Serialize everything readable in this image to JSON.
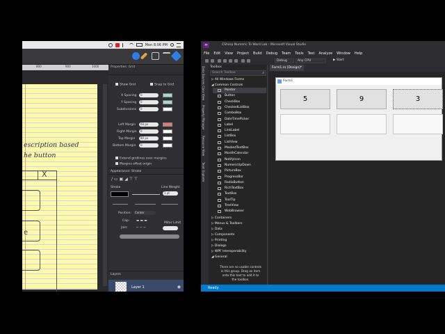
{
  "mac": {
    "menubar": {
      "clock": "Mon 8:06 PM"
    },
    "ruler": {
      "ticks": [
        "800",
        "900",
        "1000"
      ]
    },
    "pad": {
      "line1": "escription based",
      "line2": "he button",
      "x_mark": "X",
      "e_mark": "e"
    },
    "properties": {
      "title": "Properties: Grid",
      "show_grid": "Show Grid",
      "snap_to_grid": "Snap to Grid",
      "x_spacing_label": "X Spacing",
      "x_spacing_value": "0",
      "y_spacing_label": "Y Spacing",
      "y_spacing_value": "0",
      "subdivisions_label": "Subdivisions",
      "subdivisions_value": "0",
      "left_margin_label": "Left Margin",
      "left_margin_value": "60 px",
      "right_margin_label": "Right Margin",
      "right_margin_value": "0",
      "top_margin_label": "Top Margin",
      "top_margin_value": "80 px",
      "bottom_margin_label": "Bottom Margin",
      "bottom_margin_value": "0",
      "extend_gridlines": "Extend gridlines over margins",
      "margins_offset": "Margins offset origin",
      "appearance_label": "Appearance: Stroke",
      "stroke_label": "Stroke",
      "line_weight_label": "Line Weight",
      "line_weight_value": "1 pt",
      "position_label": "Position:",
      "position_value": "Center",
      "cap_label": "Cap:",
      "join_label": "Join:",
      "miter_limit_label": "Miter Limit",
      "layers_label": "Layers",
      "layer_name": "Layer 1"
    },
    "colors": {
      "swatch_teal": "#a9d8c8",
      "swatch_red": "#e27a6f",
      "pad_yellow": "#fff9a8"
    }
  },
  "vs": {
    "window_title": "CSharp Numeric To Word Lab - Microsoft Visual Studio",
    "menu": [
      "File",
      "Edit",
      "View",
      "Project",
      "Build",
      "Debug",
      "Team",
      "Tools",
      "Test",
      "Analyze",
      "Window",
      "Help"
    ],
    "toolbar": {
      "config": "Debug",
      "platform": "Any CPU",
      "start": "▶ Start"
    },
    "side_tabs": [
      "Data Sources",
      "Class View",
      "Property Manager",
      "Resource View",
      "Team Explorer"
    ],
    "toolbox": {
      "title": "Toolbox",
      "search_placeholder": "Search Toolbox",
      "all_windows_forms": "▷ All Windows Forms",
      "common_controls": "◢ Common Controls",
      "items": [
        "Pointer",
        "Button",
        "CheckBox",
        "CheckedListBox",
        "ComboBox",
        "DateTimePicker",
        "Label",
        "LinkLabel",
        "ListBox",
        "ListView",
        "MaskedTextBox",
        "MonthCalendar",
        "NotifyIcon",
        "NumericUpDown",
        "PictureBox",
        "ProgressBar",
        "RadioButton",
        "RichTextBox",
        "TextBox",
        "ToolTip",
        "TreeView",
        "WebBrowser"
      ],
      "groups": [
        "▷ Containers",
        "▷ Menus & Toolbars",
        "▷ Data",
        "▷ Components",
        "▷ Printing",
        "▷ Dialogs",
        "▷ WPF Interoperability",
        "◢ General"
      ],
      "empty_message": "There are no usable controls in this group. Drag an item onto this text to add it to the toolbox."
    },
    "designer": {
      "tab": "Form1.cs [Design]*",
      "form_title": "Form1",
      "buttons": [
        "5",
        "9",
        "3"
      ]
    },
    "status": "Ready",
    "colors": {
      "status_blue": "#007acc",
      "vs_purple": "#68217a"
    }
  }
}
